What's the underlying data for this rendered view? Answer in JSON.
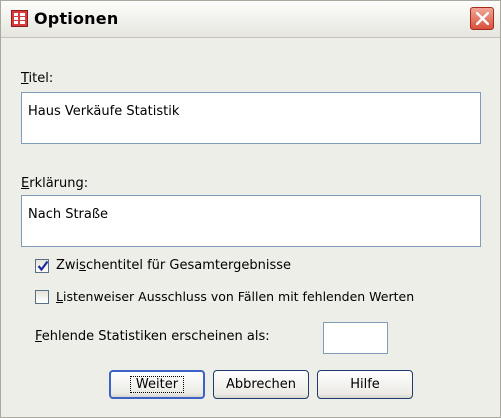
{
  "window": {
    "title": "Optionen",
    "icon": "spreadsheet-icon"
  },
  "fields": {
    "titel": {
      "label_mnemonic": "T",
      "label_rest": "itel:",
      "value": "Haus Verkäufe Statistik"
    },
    "erklaerung": {
      "label_mnemonic": "E",
      "label_rest": "rklärung:",
      "value": "Nach Straße"
    }
  },
  "checkboxes": {
    "zwischentitel": {
      "pre": "Zwi",
      "mnemonic": "s",
      "post": "chentitel für Gesamtergebnisse",
      "checked": true
    },
    "listenweiser": {
      "pre": "",
      "mnemonic": "L",
      "post": "istenweiser Ausschluss von Fällen mit fehlenden Werten",
      "checked": false
    }
  },
  "missing": {
    "label_mnemonic": "F",
    "label_rest": "ehlende Statistiken erscheinen als:",
    "value": ""
  },
  "buttons": {
    "weiter": "Weiter",
    "abbrechen": "Abbrechen",
    "hilfe": "Hilfe"
  }
}
